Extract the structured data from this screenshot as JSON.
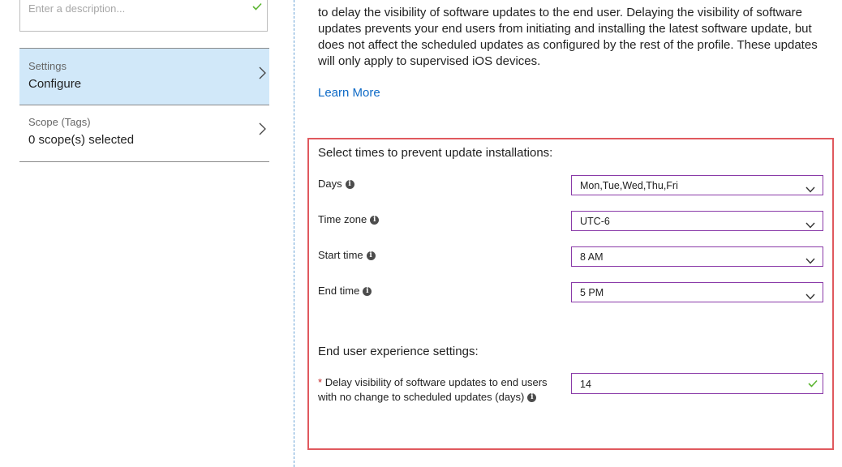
{
  "left_pane": {
    "description": {
      "placeholder": "Enter a description..."
    },
    "nav_items": [
      {
        "title": "Settings",
        "value": "Configure"
      },
      {
        "title": "Scope (Tags)",
        "value": "0 scope(s) selected"
      }
    ]
  },
  "main": {
    "intro_text": "to delay the visibility of software updates to the end user. Delaying the visibility of software updates prevents your end users from initiating and installing the latest software update, but does not affect the scheduled updates as configured by the rest of the profile. These updates will only apply to supervised iOS devices.",
    "learn_more": "Learn More",
    "schedule": {
      "heading": "Select times to prevent update installations:",
      "days": {
        "label": "Days",
        "value": "Mon,Tue,Wed,Thu,Fri"
      },
      "time_zone": {
        "label": "Time zone",
        "value": "UTC-6"
      },
      "start_time": {
        "label": "Start time",
        "value": "8 AM"
      },
      "end_time": {
        "label": "End time",
        "value": "5 PM"
      }
    },
    "end_user": {
      "heading": "End user experience settings:",
      "required_marker": "*",
      "delay_label": "Delay visibility of software updates to end users with no change to scheduled updates (days)",
      "delay_value": "14"
    }
  },
  "icons": {
    "check": "check-icon",
    "chevron_right": "chevron-right-icon",
    "chevron_down": "chevron-down-icon",
    "info": "info-icon"
  },
  "colors": {
    "selected_bg": "#d1e8f9",
    "link": "#0e6ac6",
    "highlight_border": "#e0595e",
    "field_border": "#8a3aa8",
    "check": "#5bb531"
  }
}
